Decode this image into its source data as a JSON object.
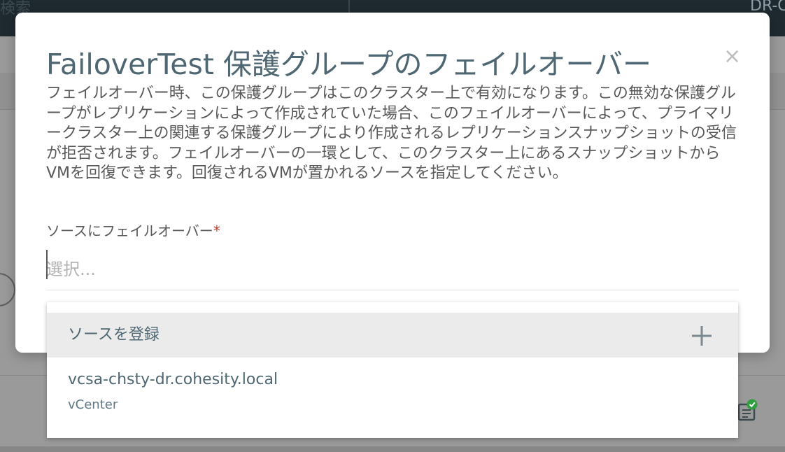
{
  "background": {
    "search_label": "検索",
    "cluster_label": "DR-C"
  },
  "modal": {
    "title": "FailoverTest 保護グループのフェイルオーバー",
    "close_label": "×",
    "description": "フェイルオーバー時、この保護グループはこのクラスター上で有効になります。この無効な保護グループがレプリケーションによって作成されていた場合、このフェイルオーバーによって、プライマリークラスター上の関連する保護グループにより作成されるレプリケーションスナップショットの受信が拒否されます。フェイルオーバーの一環として、このクラスター上にあるスナップショットからVMを回復できます。回復されるVMが置かれるソースを指定してください。",
    "field": {
      "label": "ソースにフェイルオーバー",
      "required_mark": "*",
      "placeholder": "選択...",
      "value": ""
    },
    "dropdown": {
      "register_label": "ソースを登録",
      "register_icon": "plus-icon",
      "options": [
        {
          "name": "vcsa-chsty-dr.cohesity.local",
          "type": "vCenter"
        }
      ]
    }
  },
  "colors": {
    "title": "#4e6772",
    "text": "#58595b",
    "required": "#c0392b",
    "overlay": "#8f8f8f",
    "topbar": "#1f2a30",
    "success": "#2e9e3e"
  }
}
